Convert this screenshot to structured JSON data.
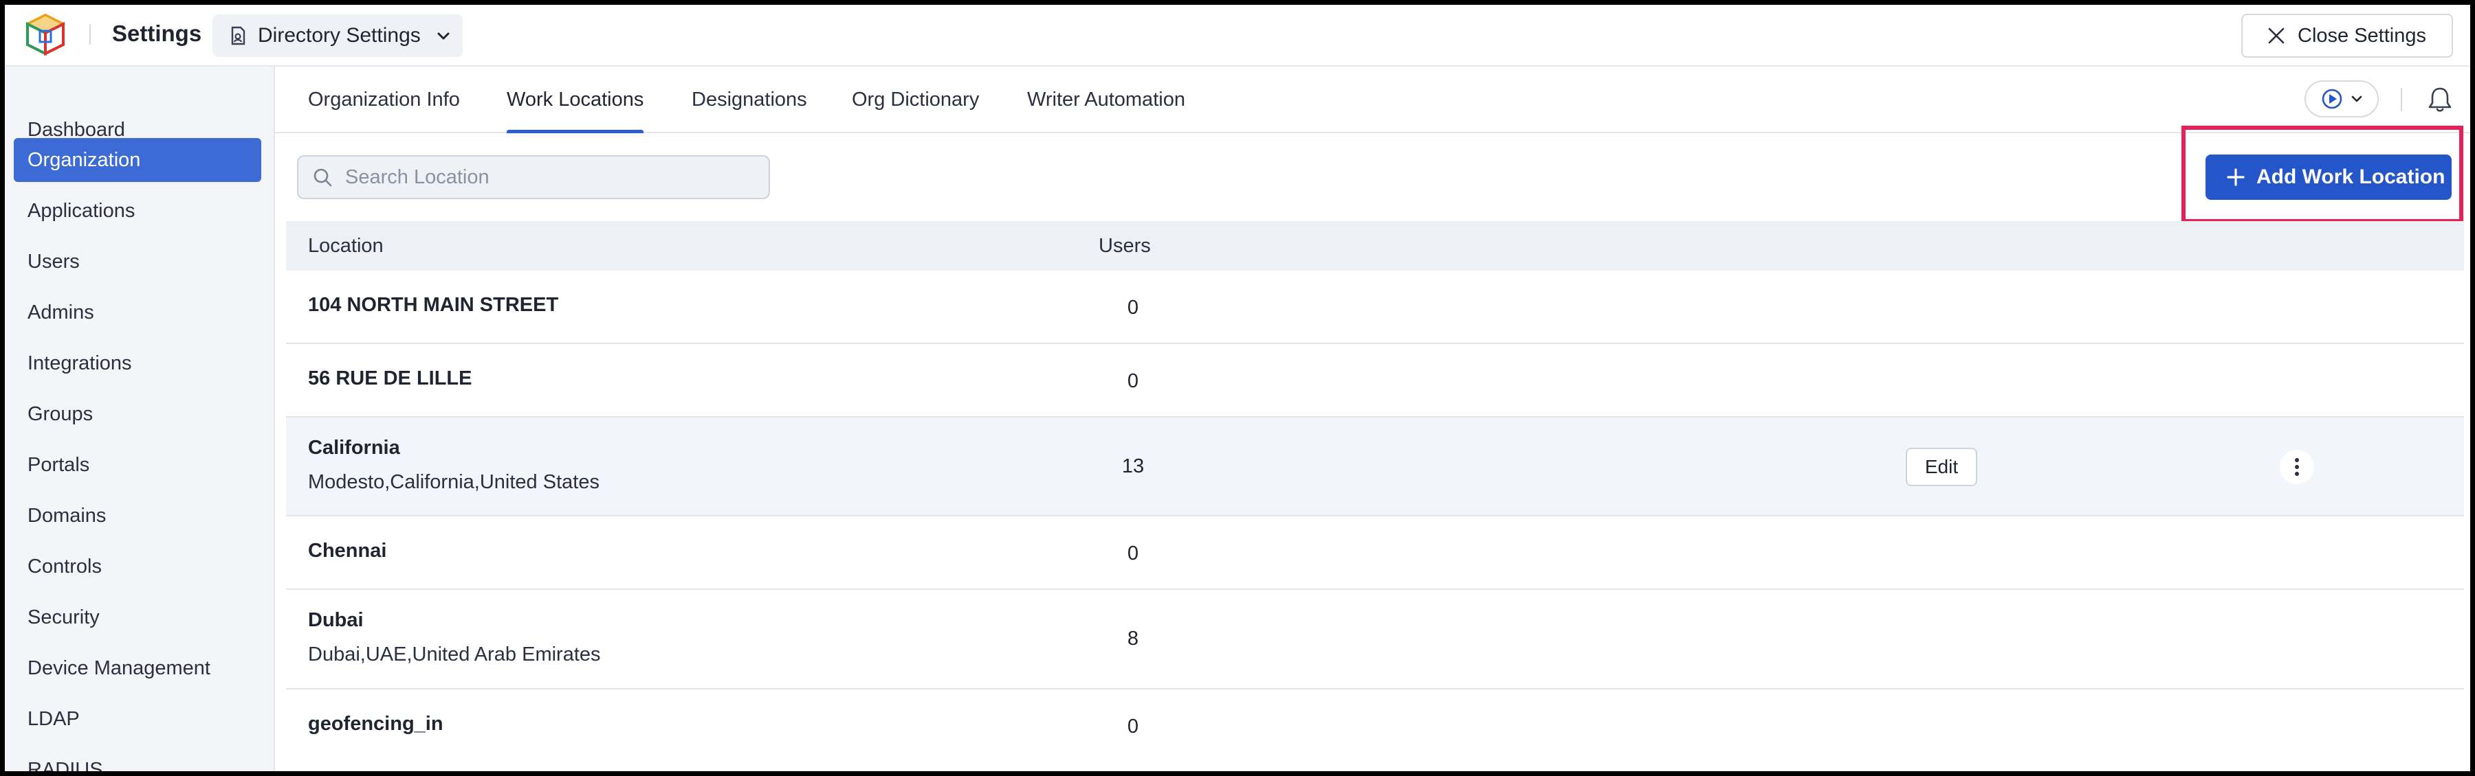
{
  "app": {
    "title": "Settings",
    "directory_label": "Directory Settings",
    "close_label": "Close Settings"
  },
  "sidebar": {
    "items": [
      {
        "label": "Dashboard",
        "active": false
      },
      {
        "label": "Organization",
        "active": true
      },
      {
        "label": "Applications",
        "active": false
      },
      {
        "label": "Users",
        "active": false
      },
      {
        "label": "Admins",
        "active": false
      },
      {
        "label": "Integrations",
        "active": false
      },
      {
        "label": "Groups",
        "active": false
      },
      {
        "label": "Portals",
        "active": false
      },
      {
        "label": "Domains",
        "active": false
      },
      {
        "label": "Controls",
        "active": false
      },
      {
        "label": "Security",
        "active": false
      },
      {
        "label": "Device Management",
        "active": false
      },
      {
        "label": "LDAP",
        "active": false
      },
      {
        "label": "RADIUS",
        "active": false
      }
    ]
  },
  "tabs": [
    {
      "label": "Organization Info",
      "active": false
    },
    {
      "label": "Work Locations",
      "active": true
    },
    {
      "label": "Designations",
      "active": false
    },
    {
      "label": "Org Dictionary",
      "active": false
    },
    {
      "label": "Writer Automation",
      "active": false
    }
  ],
  "search": {
    "placeholder": "Search Location",
    "value": ""
  },
  "add_button": {
    "label": "Add Work Location"
  },
  "table": {
    "columns": [
      "Location",
      "Users"
    ],
    "rows": [
      {
        "name": "104 NORTH MAIN STREET",
        "address": "",
        "users": "0"
      },
      {
        "name": "56 RUE DE LILLE",
        "address": "",
        "users": "0"
      },
      {
        "name": "California",
        "address": "Modesto,California,United States",
        "users": "13",
        "hovered": true,
        "edit_label": "Edit"
      },
      {
        "name": "Chennai",
        "address": "",
        "users": "0"
      },
      {
        "name": "Dubai",
        "address": "Dubai,UAE,United Arab Emirates",
        "users": "8"
      },
      {
        "name": "geofencing_in",
        "address": "",
        "users": "0"
      }
    ]
  },
  "icons": {
    "logo": "cube-logo-icon",
    "directory": "directory-icon",
    "directory_chevron": "chevron-down-icon",
    "close": "close-icon",
    "search": "search-icon",
    "add": "plus-icon",
    "demo": "play-demo-icon",
    "notifications": "bell-icon",
    "row_more": "more-vertical-icon"
  },
  "colors": {
    "accent": "#2455c9",
    "sidebar_active": "#3d6bd6",
    "highlight": "#e8205a"
  }
}
